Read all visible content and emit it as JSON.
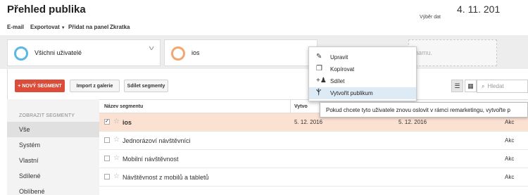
{
  "page": {
    "title": "Přehled publika",
    "date": "4. 11. 201"
  },
  "toolbar": {
    "email": "E-mail",
    "export": "Exportovat",
    "add_to_dashboard": "Přidat na panel",
    "shortcut": "Zkratka"
  },
  "segments": {
    "all_users": "Všichni uživatelé",
    "ios": "ios",
    "add_partial": "hamu."
  },
  "actions": {
    "new_segment": "+ NOVÝ SEGMENT",
    "import_gallery": "Import z galerie",
    "share_segments": "Sdílet segmenty",
    "view_label": "Výběr dat",
    "search_placeholder": "Hledat"
  },
  "sidebar": {
    "heading": "ZOBRAZIT SEGMENTY",
    "items": [
      {
        "label": "Vše"
      },
      {
        "label": "Systém"
      },
      {
        "label": "Vlastní"
      },
      {
        "label": "Sdílené"
      },
      {
        "label": "Oblíbené"
      }
    ]
  },
  "table": {
    "headers": {
      "name": "Název segmentu",
      "created": "Vytvo"
    },
    "rows": [
      {
        "name": "ios",
        "created": "5. 12. 2016",
        "modified": "5. 12. 2016",
        "action": "Akc",
        "checked": true
      },
      {
        "name": "Jednorázoví návštěvníci",
        "created": "",
        "modified": "",
        "action": "Akc",
        "checked": false
      },
      {
        "name": "Mobilní návštěvnost",
        "created": "",
        "modified": "",
        "action": "Akc",
        "checked": false
      },
      {
        "name": "Návštěvnost z mobilů a tabletů",
        "created": "",
        "modified": "",
        "action": "Akc",
        "checked": false
      }
    ]
  },
  "context_menu": {
    "items": [
      {
        "label": "Upravit",
        "icon": "pencil-icon"
      },
      {
        "label": "Kopírovat",
        "icon": "copy-icon"
      },
      {
        "label": "Sdílet",
        "icon": "share-user-icon"
      },
      {
        "label": "Vytvořit publikum",
        "icon": "fork-icon"
      }
    ]
  },
  "tooltip": {
    "text": "Pokud chcete tyto uživatele znovu oslovit v rámci remarketingu, vytvořte p"
  },
  "colors": {
    "accent_red": "#dd4b39",
    "selected_row": "#fbe1d2",
    "menu_highlight": "#dcebf6",
    "ring_blue": "#5ab7e6",
    "ring_orange": "#f5a66e"
  }
}
